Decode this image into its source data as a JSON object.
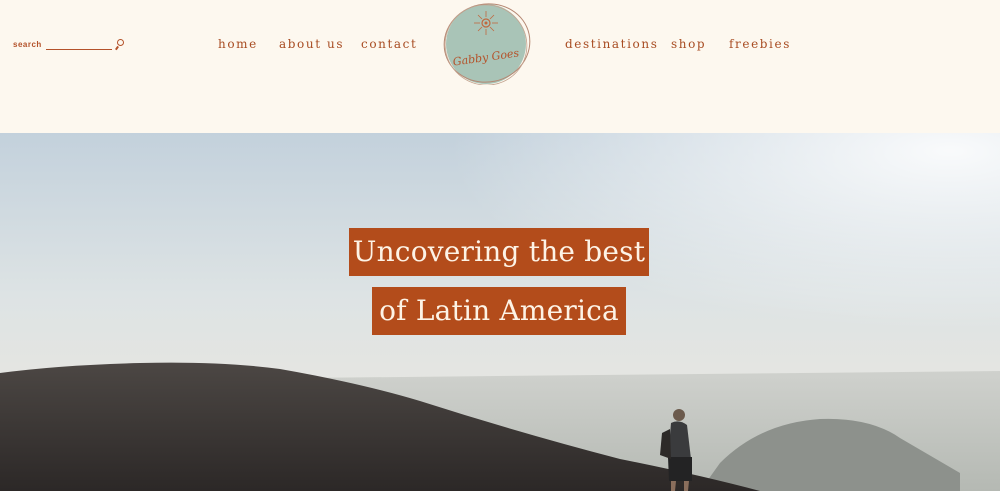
{
  "header": {
    "search": {
      "label": "search",
      "value": "",
      "placeholder": ""
    },
    "nav_left": [
      {
        "label": "home"
      },
      {
        "label": "about us"
      },
      {
        "label": "contact"
      }
    ],
    "nav_right": [
      {
        "label": "destinations"
      },
      {
        "label": "shop"
      },
      {
        "label": "freebies"
      }
    ],
    "logo": {
      "text": "Gabby Goes",
      "circle_color": "#a9c4b7",
      "accent_color": "#b4522a"
    }
  },
  "hero": {
    "headline": [
      "Uncovering the best",
      "of Latin America"
    ],
    "banner_color": "#b34c1b"
  },
  "theme": {
    "background": "#fdf8ef",
    "accent": "#a84c22"
  }
}
